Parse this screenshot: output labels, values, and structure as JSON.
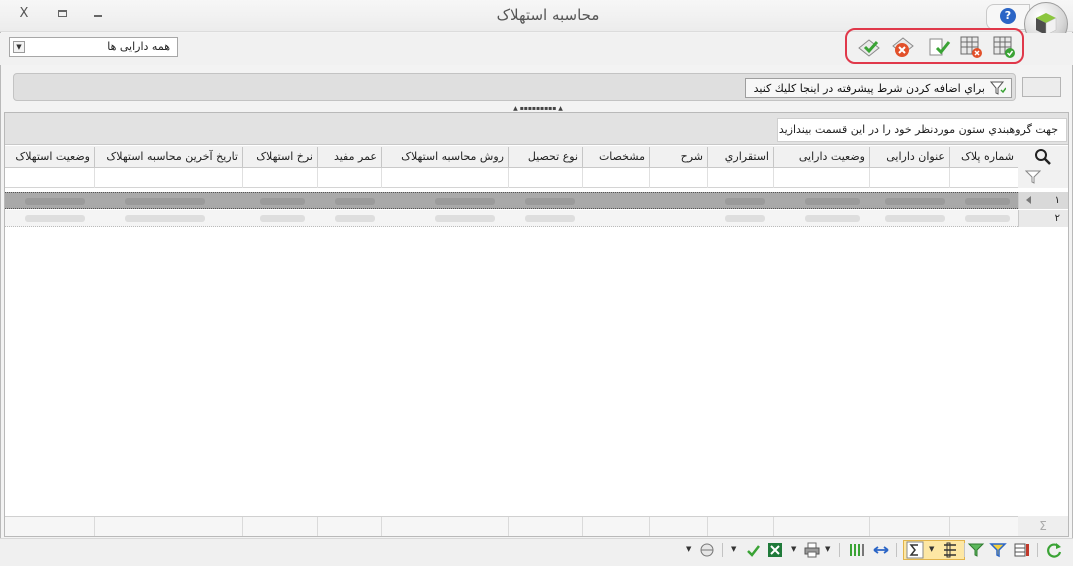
{
  "window": {
    "title": "محاسبه استهلاک",
    "close_label": "X",
    "help_label": "?"
  },
  "toolbar": {
    "asset_filter_value": "همه دارایی ها",
    "actions": [
      {
        "icon": "confirm-calc-icon"
      },
      {
        "icon": "cancel-calc-icon"
      },
      {
        "icon": "document-edit-icon"
      },
      {
        "icon": "remove-selection-icon"
      },
      {
        "icon": "approve-icon"
      }
    ]
  },
  "filter_bar": {
    "advanced_filter_label": "براي اضافه كردن شرط پيشرفته در اينجا كليك كنيد"
  },
  "grid": {
    "group_panel_hint": "جهت گروهبندي ستون موردنظر خود را در اين قسمت بيندازيد",
    "columns": [
      "شماره پلاک",
      "عنوان دارایی",
      "وضعیت دارایی",
      "استقراري",
      "شرح",
      "مشخصات",
      "نوع تحصیل",
      "روش محاسبه استهلاک",
      "عمر مفید",
      "نرخ استهلاک",
      "تاریخ آخرین محاسبه استهلاک",
      "وضعیت استهلاک"
    ],
    "rows": [
      {
        "index": "۱",
        "selected": true
      },
      {
        "index": "۲",
        "selected": false
      }
    ],
    "footer_symbol": "Σ"
  },
  "colors": {
    "highlight_border": "#e0384a",
    "selected_row": "#a9a9a9",
    "active_toolbar_group": "#fde7a4"
  }
}
